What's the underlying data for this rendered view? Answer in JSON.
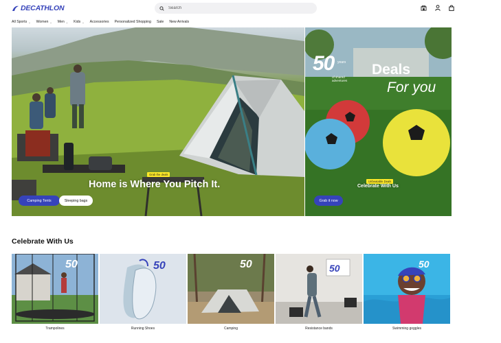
{
  "brand": {
    "name": "DECATHLON",
    "color": "#3643ba"
  },
  "search": {
    "placeholder": "Search"
  },
  "header_icons": [
    "store-icon",
    "account-icon",
    "cart-icon"
  ],
  "nav": {
    "items": [
      {
        "label": "All Sports",
        "has_dropdown": true
      },
      {
        "label": "Women",
        "has_dropdown": true
      },
      {
        "label": "Men",
        "has_dropdown": true
      },
      {
        "label": "Kids",
        "has_dropdown": true
      },
      {
        "label": "Accessories",
        "has_dropdown": false
      },
      {
        "label": "Personalized Shopping",
        "has_dropdown": false
      },
      {
        "label": "Sale",
        "has_dropdown": false
      },
      {
        "label": "New Arrivals",
        "has_dropdown": false
      }
    ]
  },
  "hero_left": {
    "tag": "Grab the deals",
    "title": "Home is Where You Pitch It.",
    "buttons": [
      "Camping Tents",
      "Sleeping bags"
    ]
  },
  "hero_right": {
    "badge_number": "50",
    "badge_years": "years",
    "badge_sub": "of shared adventures",
    "deals_line1": "Deals",
    "deals_line2": "For you",
    "tag": "Unbeatable Deals",
    "title": "Celebrate With Us",
    "button": "Grab it now"
  },
  "section": {
    "title": "Celebrate With Us",
    "cards": [
      {
        "label": "Trampolines"
      },
      {
        "label": "Running Shoes"
      },
      {
        "label": "Camping"
      },
      {
        "label": "Resistance bands"
      },
      {
        "label": "Swimming goggles"
      }
    ]
  },
  "colors": {
    "accent": "#3643ba",
    "tag": "#ffea28"
  }
}
